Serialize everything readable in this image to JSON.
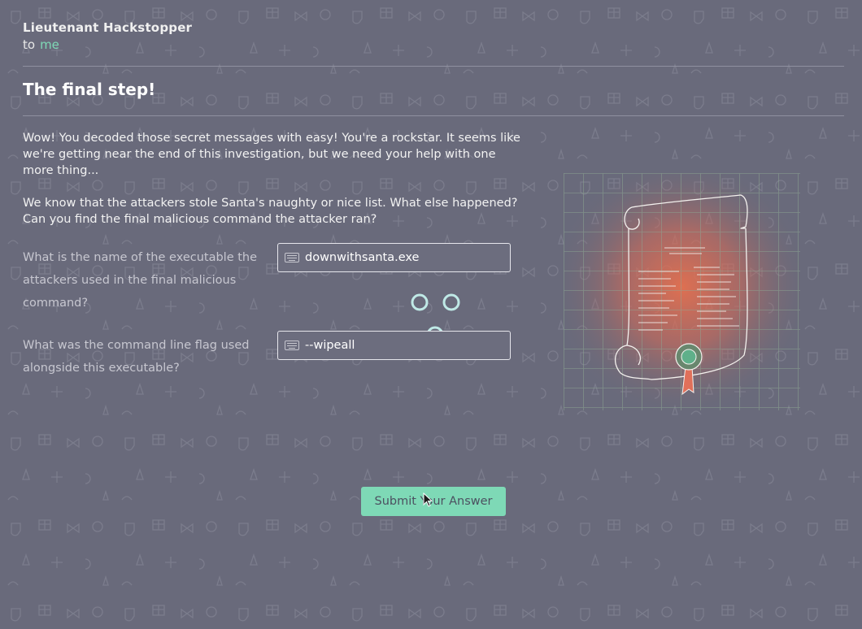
{
  "email": {
    "sender": "Lieutenant Hackstopper",
    "to_label": "to",
    "recipient": "me",
    "title": "The final step!",
    "paragraphs": [
      "Wow! You decoded those secret messages with easy! You're a rockstar. It seems like we're getting near the end of this investigation, but we need your help with one more thing...",
      "We know that the attackers stole Santa's naughty or nice list. What else happened? Can you find the final malicious command the attacker ran?"
    ]
  },
  "questions": [
    {
      "label": "What is the name of the executable the attackers used in the final malicious command?",
      "value": "downwithsanta.exe",
      "icon": "keyboard-icon"
    },
    {
      "label": "What was the command line flag used alongside this executable?",
      "value": "--wipeall",
      "icon": "keyboard-icon"
    }
  ],
  "submit": {
    "label": "Submit Your Answer"
  },
  "colors": {
    "background": "#696a7b",
    "accent": "#7ed9b6",
    "glow": "#e4704f"
  },
  "illustration": {
    "icon": "scroll-icon"
  }
}
